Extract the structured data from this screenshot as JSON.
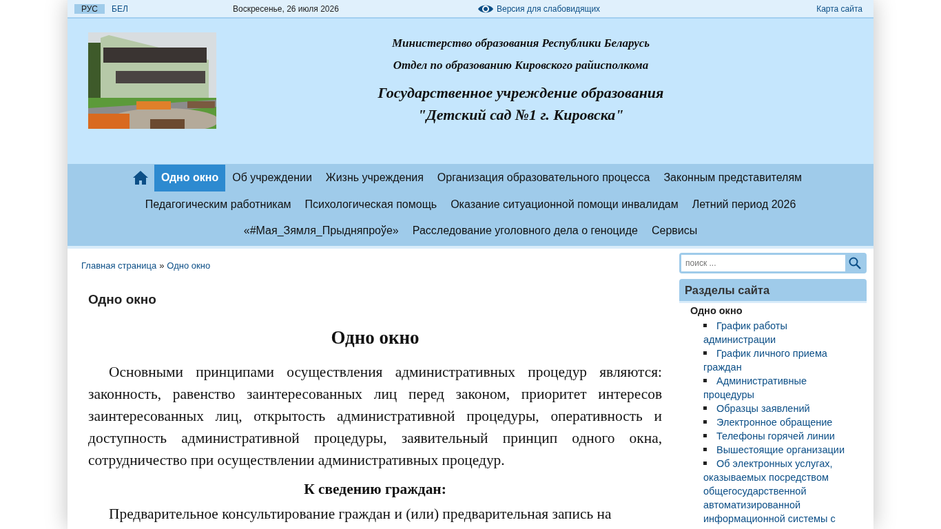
{
  "top_bar": {
    "languages": [
      {
        "label": "РУС",
        "selected": true
      },
      {
        "label": "БЕЛ",
        "selected": false
      }
    ],
    "date": "Воскресенье, 26 июля 2026",
    "accessibility_link": "Версия для слабовидящих",
    "sitemap_link": "Карта сайта"
  },
  "header": {
    "ministry": "Министерство образования Республики Беларусь",
    "department": "Отдел по образованию Кировского райисполкома",
    "institution": [
      "Государственное учреждение образования",
      "\"Детский сад №1 г. Кировска\""
    ]
  },
  "nav": {
    "items": [
      {
        "label": "Одно окно",
        "selected": true
      },
      {
        "label": "Об учреждении",
        "selected": false
      },
      {
        "label": "Жизнь учреждения",
        "selected": false
      },
      {
        "label": "Организация образовательного процесса",
        "selected": false
      },
      {
        "label": "Законным представителям",
        "selected": false
      },
      {
        "label": "Педагогическим работникам",
        "selected": false
      },
      {
        "label": "Психологическая помощь",
        "selected": false
      },
      {
        "label": "Оказание ситуационной помощи инвалидам",
        "selected": false
      },
      {
        "label": "Летний период 2026",
        "selected": false
      },
      {
        "label": "«#Мая_Зямля_Прыдняпроўе»",
        "selected": false
      },
      {
        "label": "Расследование уголовного дела о геноциде",
        "selected": false
      },
      {
        "label": "Сервисы",
        "selected": false
      }
    ]
  },
  "breadcrumb": {
    "items": [
      "Главная страница",
      "Одно окно"
    ],
    "separator": "»"
  },
  "page_title": "Одно окно",
  "article": {
    "heading": "Одно окно",
    "paragraph": "Основными принципами осуществления административных процедур являются: законность, равенство заинтересованных лиц перед законом, приоритет интересов заинтересованных лиц, открытость административной процедуры, оперативность и доступность административной процедуры, заявительный принцип одного окна, сотрудничество при осуществлении административных процедур.",
    "subheading": "К сведению граждан:",
    "paragraph_2": "Предварительное консультирование граждан и (или) предварительная запись на"
  },
  "sidebar": {
    "search": {
      "placeholder": "поиск ..."
    },
    "title": "Разделы сайта",
    "current": "Одно окно",
    "links": [
      "График работы администрации",
      "График личного приема граждан",
      "Административные процедуры",
      "Образцы заявлений",
      "Электронное обращение",
      "Телефоны горячей линии",
      "Вышестоящие организации",
      "Об электронных услугах, оказываемых посредством общегосударственной автоматизированной информационной системы с"
    ]
  }
}
